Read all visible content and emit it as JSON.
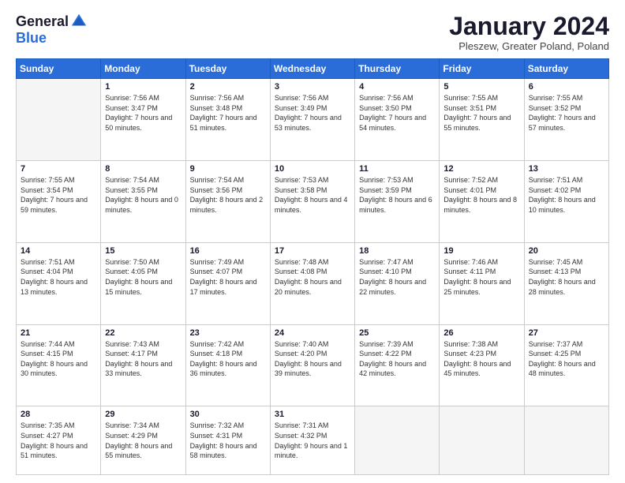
{
  "logo": {
    "general": "General",
    "blue": "Blue"
  },
  "header": {
    "month": "January 2024",
    "location": "Pleszew, Greater Poland, Poland"
  },
  "weekdays": [
    "Sunday",
    "Monday",
    "Tuesday",
    "Wednesday",
    "Thursday",
    "Friday",
    "Saturday"
  ],
  "weeks": [
    [
      {
        "day": "",
        "empty": true
      },
      {
        "day": "1",
        "sunrise": "7:56 AM",
        "sunset": "3:47 PM",
        "daylight": "7 hours and 50 minutes."
      },
      {
        "day": "2",
        "sunrise": "7:56 AM",
        "sunset": "3:48 PM",
        "daylight": "7 hours and 51 minutes."
      },
      {
        "day": "3",
        "sunrise": "7:56 AM",
        "sunset": "3:49 PM",
        "daylight": "7 hours and 53 minutes."
      },
      {
        "day": "4",
        "sunrise": "7:56 AM",
        "sunset": "3:50 PM",
        "daylight": "7 hours and 54 minutes."
      },
      {
        "day": "5",
        "sunrise": "7:55 AM",
        "sunset": "3:51 PM",
        "daylight": "7 hours and 55 minutes."
      },
      {
        "day": "6",
        "sunrise": "7:55 AM",
        "sunset": "3:52 PM",
        "daylight": "7 hours and 57 minutes."
      }
    ],
    [
      {
        "day": "7",
        "sunrise": "7:55 AM",
        "sunset": "3:54 PM",
        "daylight": "7 hours and 59 minutes."
      },
      {
        "day": "8",
        "sunrise": "7:54 AM",
        "sunset": "3:55 PM",
        "daylight": "8 hours and 0 minutes."
      },
      {
        "day": "9",
        "sunrise": "7:54 AM",
        "sunset": "3:56 PM",
        "daylight": "8 hours and 2 minutes."
      },
      {
        "day": "10",
        "sunrise": "7:53 AM",
        "sunset": "3:58 PM",
        "daylight": "8 hours and 4 minutes."
      },
      {
        "day": "11",
        "sunrise": "7:53 AM",
        "sunset": "3:59 PM",
        "daylight": "8 hours and 6 minutes."
      },
      {
        "day": "12",
        "sunrise": "7:52 AM",
        "sunset": "4:01 PM",
        "daylight": "8 hours and 8 minutes."
      },
      {
        "day": "13",
        "sunrise": "7:51 AM",
        "sunset": "4:02 PM",
        "daylight": "8 hours and 10 minutes."
      }
    ],
    [
      {
        "day": "14",
        "sunrise": "7:51 AM",
        "sunset": "4:04 PM",
        "daylight": "8 hours and 13 minutes."
      },
      {
        "day": "15",
        "sunrise": "7:50 AM",
        "sunset": "4:05 PM",
        "daylight": "8 hours and 15 minutes."
      },
      {
        "day": "16",
        "sunrise": "7:49 AM",
        "sunset": "4:07 PM",
        "daylight": "8 hours and 17 minutes."
      },
      {
        "day": "17",
        "sunrise": "7:48 AM",
        "sunset": "4:08 PM",
        "daylight": "8 hours and 20 minutes."
      },
      {
        "day": "18",
        "sunrise": "7:47 AM",
        "sunset": "4:10 PM",
        "daylight": "8 hours and 22 minutes."
      },
      {
        "day": "19",
        "sunrise": "7:46 AM",
        "sunset": "4:11 PM",
        "daylight": "8 hours and 25 minutes."
      },
      {
        "day": "20",
        "sunrise": "7:45 AM",
        "sunset": "4:13 PM",
        "daylight": "8 hours and 28 minutes."
      }
    ],
    [
      {
        "day": "21",
        "sunrise": "7:44 AM",
        "sunset": "4:15 PM",
        "daylight": "8 hours and 30 minutes."
      },
      {
        "day": "22",
        "sunrise": "7:43 AM",
        "sunset": "4:17 PM",
        "daylight": "8 hours and 33 minutes."
      },
      {
        "day": "23",
        "sunrise": "7:42 AM",
        "sunset": "4:18 PM",
        "daylight": "8 hours and 36 minutes."
      },
      {
        "day": "24",
        "sunrise": "7:40 AM",
        "sunset": "4:20 PM",
        "daylight": "8 hours and 39 minutes."
      },
      {
        "day": "25",
        "sunrise": "7:39 AM",
        "sunset": "4:22 PM",
        "daylight": "8 hours and 42 minutes."
      },
      {
        "day": "26",
        "sunrise": "7:38 AM",
        "sunset": "4:23 PM",
        "daylight": "8 hours and 45 minutes."
      },
      {
        "day": "27",
        "sunrise": "7:37 AM",
        "sunset": "4:25 PM",
        "daylight": "8 hours and 48 minutes."
      }
    ],
    [
      {
        "day": "28",
        "sunrise": "7:35 AM",
        "sunset": "4:27 PM",
        "daylight": "8 hours and 51 minutes."
      },
      {
        "day": "29",
        "sunrise": "7:34 AM",
        "sunset": "4:29 PM",
        "daylight": "8 hours and 55 minutes."
      },
      {
        "day": "30",
        "sunrise": "7:32 AM",
        "sunset": "4:31 PM",
        "daylight": "8 hours and 58 minutes."
      },
      {
        "day": "31",
        "sunrise": "7:31 AM",
        "sunset": "4:32 PM",
        "daylight": "9 hours and 1 minute."
      },
      {
        "day": "",
        "empty": true
      },
      {
        "day": "",
        "empty": true
      },
      {
        "day": "",
        "empty": true
      }
    ]
  ]
}
